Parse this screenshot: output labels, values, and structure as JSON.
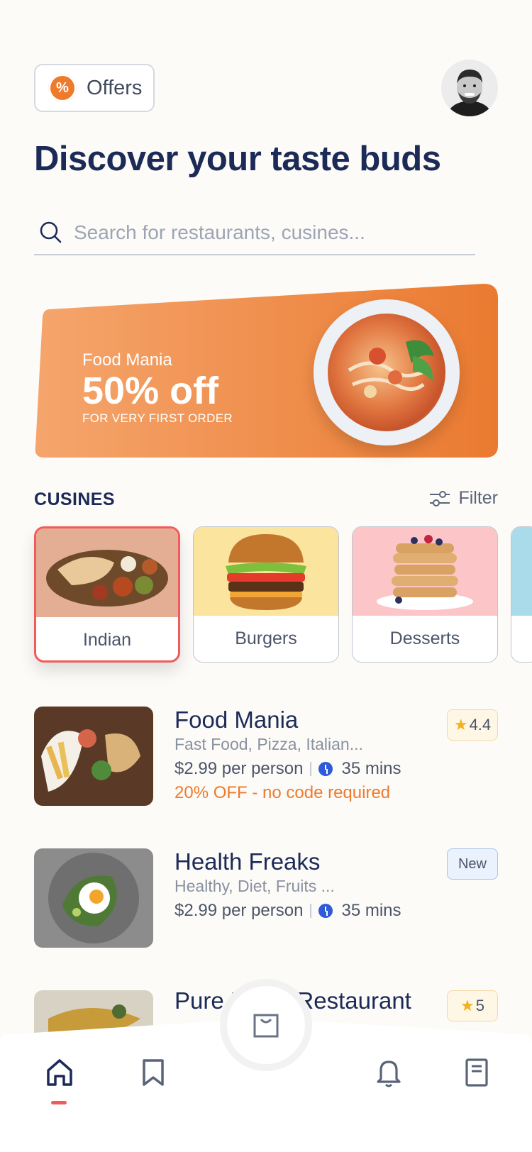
{
  "header": {
    "offers_badge": "%",
    "offers_label": "Offers",
    "headline": "Discover your taste buds"
  },
  "search": {
    "placeholder": "Search for restaurants, cusines..."
  },
  "banner": {
    "brand": "Food Mania",
    "deal": "50% off",
    "subtitle": "FOR VERY FIRST ORDER"
  },
  "cuisines": {
    "title": "CUSINES",
    "filter_label": "Filter",
    "items": [
      {
        "label": "Indian",
        "selected": true,
        "bg": "#E3AE93"
      },
      {
        "label": "Burgers",
        "selected": false,
        "bg": "#FBE49D"
      },
      {
        "label": "Desserts",
        "selected": false,
        "bg": "#FCC6C9"
      }
    ]
  },
  "restaurants": [
    {
      "name": "Food Mania",
      "tags": "Fast Food, Pizza, Italian...",
      "price": "$2.99 per person",
      "time": "35 mins",
      "offer": "20% OFF - no code required",
      "rating": "4.4"
    },
    {
      "name": "Health Freaks",
      "tags": "Healthy, Diet, Fruits ...",
      "price": "$2.99 per person",
      "time": "35 mins",
      "badge": "New"
    },
    {
      "name": "Pure Pasta Restaurant",
      "rating": "5"
    }
  ],
  "tabbar": {
    "active": "home",
    "tabs": [
      "home-icon",
      "bookmark-icon",
      "cart-icon",
      "bell-icon",
      "orders-icon"
    ]
  },
  "colors": {
    "primary": "#1C2A57",
    "accent": "#EE7A2C",
    "selection": "#F25B5B",
    "clock": "#2E5BD8"
  }
}
